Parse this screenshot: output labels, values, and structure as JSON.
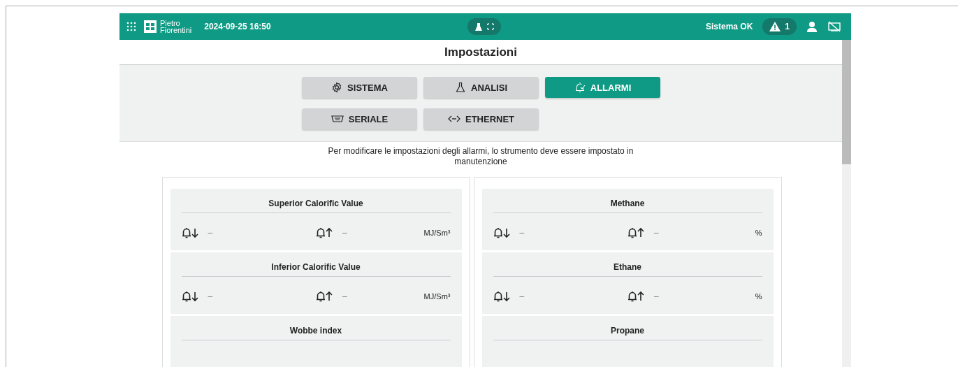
{
  "header": {
    "logo": [
      "Pietro",
      "Fiorentini"
    ],
    "datetime": "2024-09-25 16:50",
    "status": "Sistema OK",
    "alarm_count": "1"
  },
  "page_title": "Impostazioni",
  "tabs": [
    {
      "label": "SISTEMA",
      "kind": "system",
      "selected": false
    },
    {
      "label": "ANALISI",
      "kind": "analysis",
      "selected": false
    },
    {
      "label": "ALLARMI",
      "kind": "alarms",
      "selected": true
    },
    {
      "label": "SERIALE",
      "kind": "serial",
      "selected": false
    },
    {
      "label": "ETHERNET",
      "kind": "ethernet",
      "selected": false
    }
  ],
  "notice": "Per modificare le impostazioni degli allarmi, lo strumento deve essere impostato in manutenzione",
  "panels": [
    {
      "cards": [
        {
          "title": "Superior Calorific Value",
          "low": "–",
          "high": "–",
          "unit": "MJ/Sm³"
        },
        {
          "title": "Inferior Calorific Value",
          "low": "–",
          "high": "–",
          "unit": "MJ/Sm³"
        },
        {
          "title": "Wobbe index"
        }
      ]
    },
    {
      "cards": [
        {
          "title": "Methane",
          "low": "–",
          "high": "–",
          "unit": "%"
        },
        {
          "title": "Ethane",
          "low": "–",
          "high": "–",
          "unit": "%"
        },
        {
          "title": "Propane"
        }
      ]
    }
  ]
}
